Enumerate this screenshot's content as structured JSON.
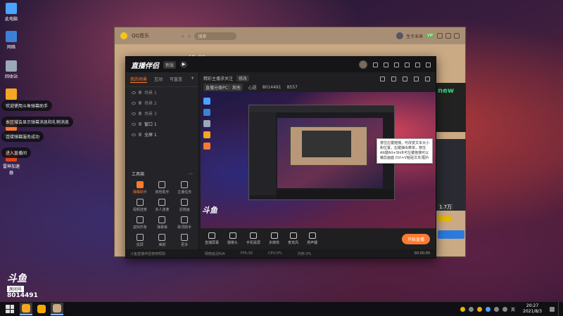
{
  "desktop": {
    "icons": [
      {
        "label": "此电脑",
        "color": "#4aa3ff"
      },
      {
        "label": "网络",
        "color": "#3b82d6"
      },
      {
        "label": "回收站",
        "color": "#9aa8b8"
      },
      {
        "label": "斗鱼直播",
        "color": "#f5a623"
      },
      {
        "label": "直播伴侣",
        "color": "#ff7a2f"
      },
      {
        "label": "雷神加速器",
        "color": "#e0441a"
      }
    ],
    "notifications": [
      "欢迎使用斗鱼弹幕助手",
      "本区域会显示弹幕消息和礼物消息",
      "连接弹幕服务成功",
      "进入直播间"
    ]
  },
  "qq_music": {
    "app_name": "QQ音乐",
    "search_placeholder": "搜索",
    "username": "生于未来",
    "badge": "VIP",
    "heading": "推荐",
    "promo_text": "new",
    "price_text": "1.7万"
  },
  "douyu": {
    "logo": "直播伴侣",
    "version": "新版",
    "play_icon": "▶",
    "sidebar": {
      "tabs": [
        "我的场景",
        "互动",
        "可直连"
      ],
      "add": "+",
      "scenes": [
        "场景 1",
        "场景 2",
        "场景 3",
        "窗口 1",
        "全屏 1"
      ],
      "tools_title": "工具箱",
      "tools_more": "…",
      "tools": [
        {
          "label": "弹幕助手",
          "hot": true
        },
        {
          "label": "房管助手",
          "hot": false
        },
        {
          "label": "主播任务",
          "hot": false
        },
        {
          "label": "视频连麦",
          "hot": false
        },
        {
          "label": "多人连麦",
          "hot": false
        },
        {
          "label": "滤镜画",
          "hot": false
        },
        {
          "label": "虚拟形象",
          "hot": false
        },
        {
          "label": "弹幕板",
          "hot": false
        },
        {
          "label": "歌词助手",
          "hot": false
        },
        {
          "label": "投屏",
          "hot": false
        },
        {
          "label": "美颜",
          "hot": false
        },
        {
          "label": "更多",
          "hot": false
        }
      ],
      "footer": "斗鱼直播伴侣使用帮助"
    },
    "stream_info": {
      "title": "精彩主播求关注",
      "edit": "修改",
      "category": "直播分类PC：其他",
      "hot": "8014491",
      "hot_label": "心愿",
      "fans": "8557"
    },
    "tooltip": "按住左键拖拽，可改变文本大小和位置，右键弹出菜单，按住Alt键Alt+Shift可左键拖拽可以裁剪画面 Ctrl+V粘贴文本/图片",
    "watermark": "斗鱼",
    "controls": [
      "直播屏幕",
      "摄像头",
      "手机投屏",
      "多媒体",
      "麦克风",
      "扬声器"
    ],
    "start_button": "开始直播",
    "status": [
      "网络延迟N/A",
      "FPS:30",
      "CPU:0%",
      "内存:0%"
    ],
    "status_time": "00:00:00"
  },
  "brand_mark": {
    "line1": "斗鱼",
    "line2": "房间号",
    "room_id": "8014491"
  },
  "taskbar": {
    "apps": [
      {
        "name": "douyu",
        "color": "#f5a623"
      },
      {
        "name": "g-app",
        "color": "#f2a900"
      },
      {
        "name": "qq-music",
        "color": "#caa985"
      }
    ],
    "tray_lang": "英",
    "time": "20:27",
    "date": "2021/8/3"
  }
}
